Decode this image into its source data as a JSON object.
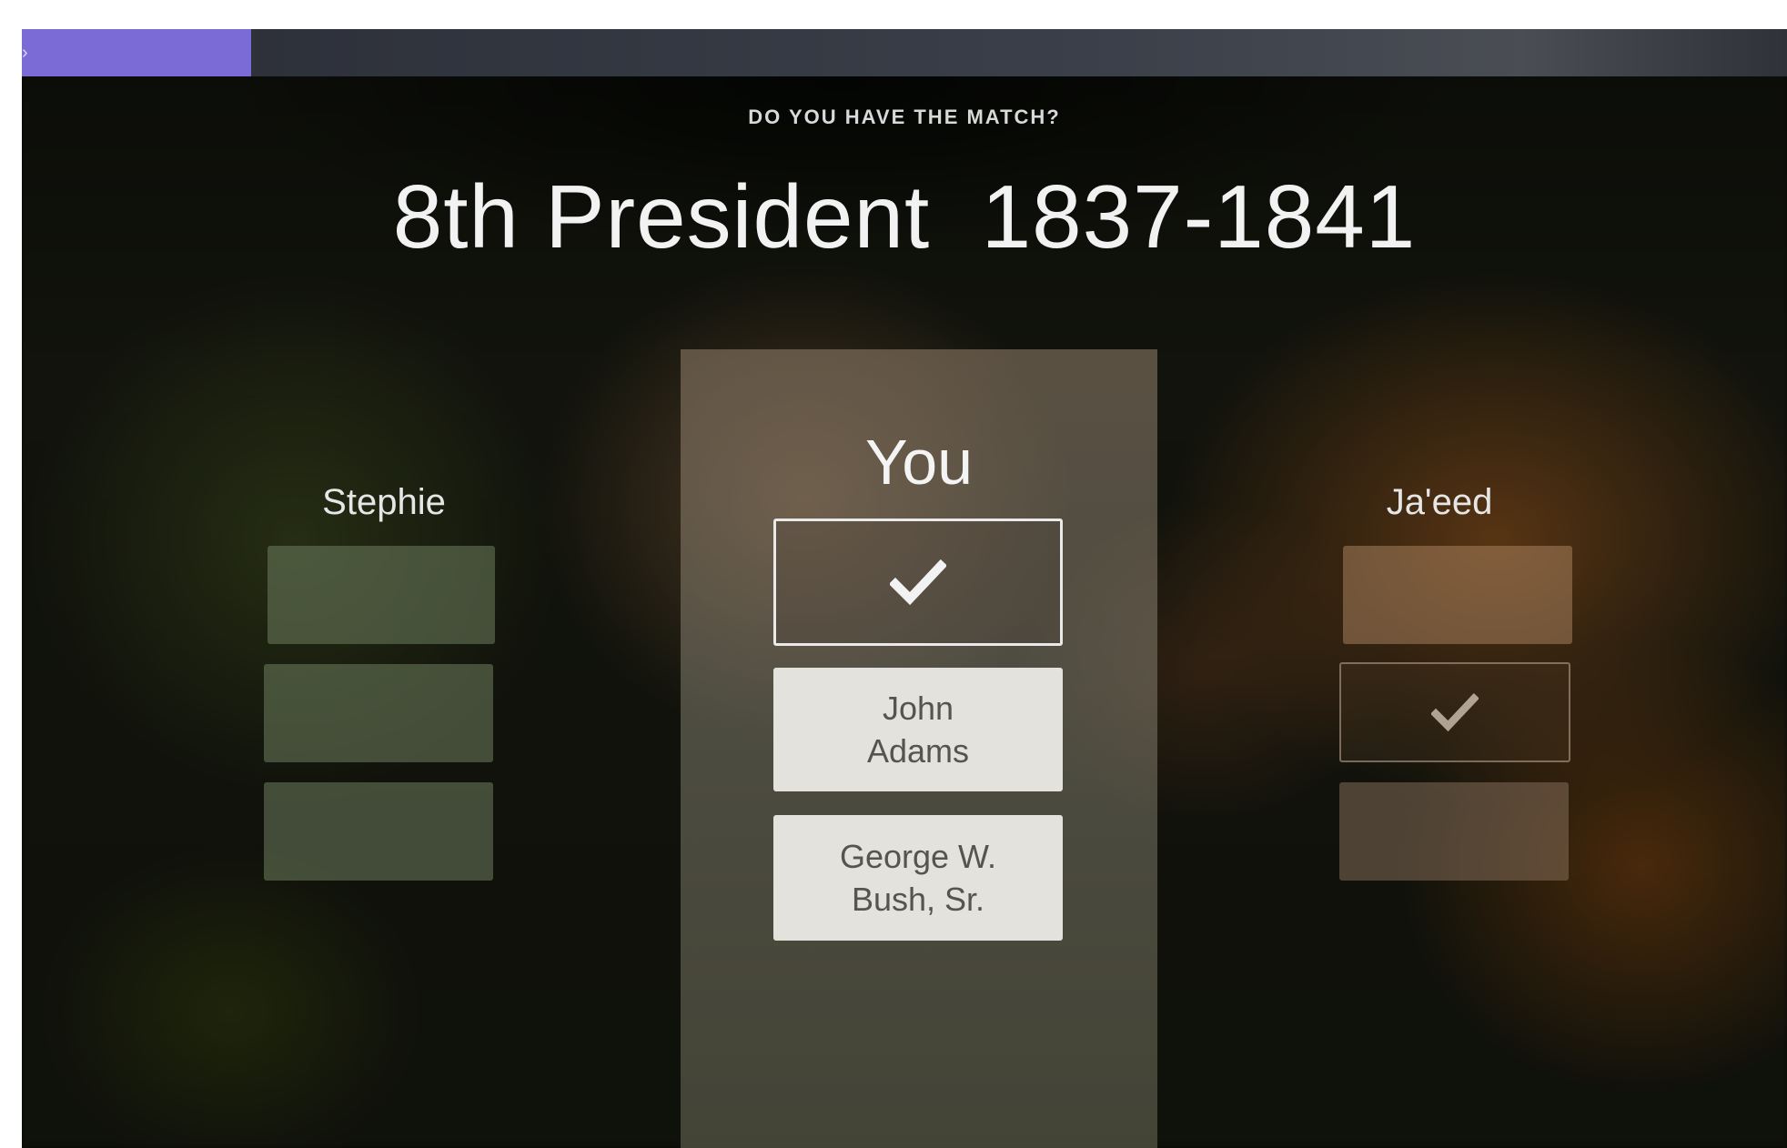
{
  "progress": {
    "fraction": 0.13
  },
  "prompt": "DO YOU HAVE THE MATCH?",
  "question": "8th President  1837-1841",
  "players": {
    "left": {
      "name": "Stephie"
    },
    "center": {
      "name": "You",
      "answers": [
        "John\nAdams",
        "George W.\nBush, Sr."
      ]
    },
    "right": {
      "name": "Ja'eed"
    }
  },
  "colors": {
    "accent": "#7a6bd6",
    "answer_tile": "#e3e2dd",
    "answer_text": "#55554f"
  },
  "icons": {
    "selected_mark": "check-icon",
    "opponent_mark": "check-icon"
  }
}
